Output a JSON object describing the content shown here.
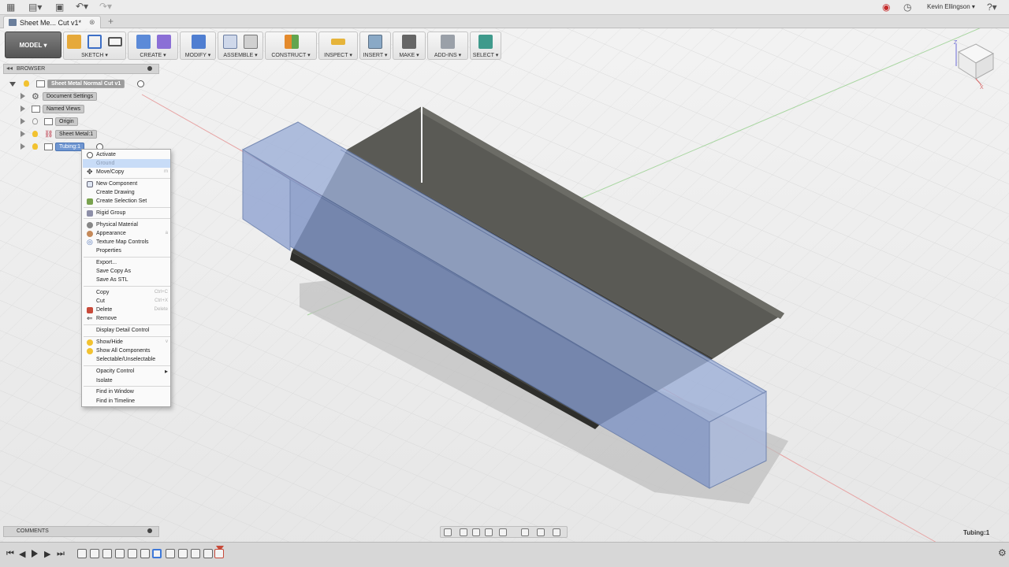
{
  "app": {
    "tab_title": "Sheet Me... Cut v1*",
    "tab_close": "⊗",
    "tab_plus": "+",
    "user": "Kevin Ellingson ▾",
    "status_selection": "Tubing:1"
  },
  "toolbar": {
    "workspace": "MODEL ▾",
    "groups": {
      "sketch": "SKETCH ▾",
      "create": "CREATE ▾",
      "modify": "MODIFY ▾",
      "assemble": "ASSEMBLE ▾",
      "construct": "CONSTRUCT ▾",
      "inspect": "INSPECT ▾",
      "insert": "INSERT ▾",
      "make": "MAKE ▾",
      "addins": "ADD-INS ▾",
      "select": "SELECT ▾"
    }
  },
  "browser": {
    "header": "BROWSER",
    "root": "Sheet Metal Normal Cut v1",
    "items": {
      "doc_settings": "Document Settings",
      "named_views": "Named Views",
      "origin": "Origin",
      "sheet_metal": "Sheet Metal:1",
      "tubing": "Tubing:1"
    }
  },
  "context_menu": {
    "activate": "Activate",
    "ground": "Ground",
    "move_copy": "Move/Copy",
    "move_copy_sc": "m",
    "new_component": "New Component",
    "create_drawing": "Create Drawing",
    "create_selection_set": "Create Selection Set",
    "rigid_group": "Rigid Group",
    "physical_material": "Physical Material",
    "appearance": "Appearance",
    "appearance_sc": "a",
    "texture_map": "Texture Map Controls",
    "properties": "Properties",
    "export": "Export...",
    "save_copy_as": "Save Copy As",
    "save_as_stl": "Save As STL",
    "copy": "Copy",
    "copy_sc": "Ctrl+C",
    "cut": "Cut",
    "cut_sc": "Ctrl+X",
    "delete": "Delete",
    "delete_sc": "Delete",
    "remove": "Remove",
    "display_detail": "Display Detail Control",
    "show_hide": "Show/Hide",
    "show_hide_sc": "v",
    "show_all": "Show All Components",
    "selectable": "Selectable/Unselectable",
    "opacity": "Opacity Control",
    "opacity_arrow": "▸",
    "isolate": "Isolate",
    "find_window": "Find in Window",
    "find_timeline": "Find in Timeline"
  },
  "comments": {
    "label": "COMMENTS"
  },
  "viewcube": {
    "axis_z": "Z",
    "axis_x": "X"
  },
  "colors": {
    "tube_fill": "#8ea3cf",
    "tube_edge": "#5f76a8",
    "sheet_dark": "#4a4a44",
    "selection_blue": "#6f96d1"
  }
}
